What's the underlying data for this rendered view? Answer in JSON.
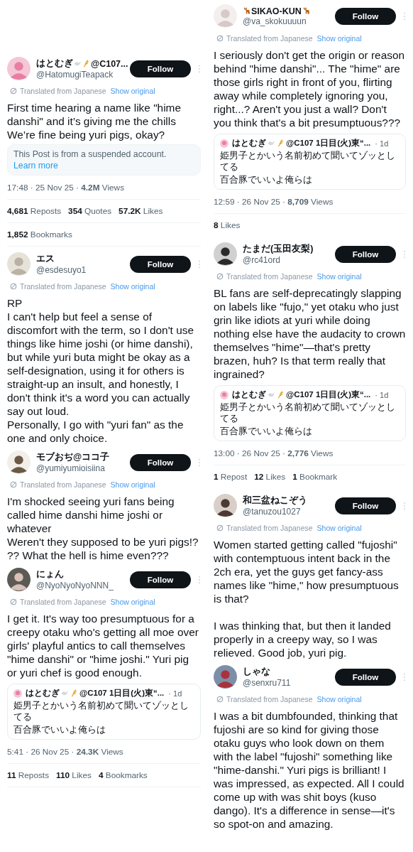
{
  "columns": [
    {
      "posts": [
        {
          "name_parts": [
            {
              "kind": "text",
              "text": "はとむぎ"
            },
            {
              "kind": "dove"
            },
            {
              "kind": "wheat"
            },
            {
              "kind": "text",
              "text": "@C107..."
            }
          ],
          "handle": "@HatomugiTeapack",
          "follow": "Follow",
          "translated": "Translated from Japanese",
          "show_original": "Show original",
          "body": [
            [
              "First time hearing a name like \"hime danshi\" and it’s giving me the chills",
              "We’re fine being yuri pigs, okay?"
            ]
          ],
          "notice": {
            "text": "This Post is from a suspended account.",
            "link": "Learn more"
          },
          "meta": "17:48 · 25 Nov 25 · **4.2M** Views",
          "stats": [
            [
              {
                "count": "4,681",
                "label": "Reposts"
              },
              {
                "count": "354",
                "label": "Quotes"
              },
              {
                "count": "57.2K",
                "label": "Likes"
              }
            ],
            [
              {
                "count": "1,852",
                "label": "Bookmarks"
              }
            ]
          ]
        },
        {
          "name_parts": [
            {
              "kind": "text",
              "text": "エス"
            }
          ],
          "handle": "@esdesuyo1",
          "follow": "Follow",
          "translated": "Translated from Japanese",
          "show_original": "Show original",
          "body": [
            [
              "RP",
              "I can't help but feel a sense of discomfort with the term, so I don't use things like hime joshi (or hime danshi), but while yuri buta might be okay as a self-designation, using it for others is straight-up an insult, and honestly, I don't think it's a word you can actually say out loud.",
              "Personally, I go with \"yuri fan\" as the one and only choice."
            ]
          ]
        },
        {
          "name_parts": [
            {
              "kind": "text",
              "text": "モブおぢ@ココ子"
            }
          ],
          "handle": "@yumiyumioisiina",
          "follow": "Follow",
          "translated": "Translated from Japanese",
          "show_original": "Show original",
          "body": [
            [
              "I'm shocked seeing yuri fans being called hime danshi hime joshi or whatever",
              "Weren't they supposed to be yuri pigs!? ?? What the hell is hime even???"
            ]
          ]
        },
        {
          "name_parts": [
            {
              "kind": "text",
              "text": "にょん"
            }
          ],
          "handle": "@NyoNyoNyoNNN_",
          "follow": "Follow",
          "translated": "Translated from Japanese",
          "show_original": "Show original",
          "body": [
            [
              "I get it. It's way too presumptuous for a creepy otaku who's getting all moe over girls' playful antics to call themselves \"hime danshi\" or \"hime joshi.\" Yuri pig or yuri chef is good enough."
            ]
          ],
          "quote": {
            "name_parts": [
              {
                "kind": "text",
                "text": "はとむぎ"
              },
              {
                "kind": "dove"
              },
              {
                "kind": "wheat"
              },
              {
                "kind": "text",
                "text": "@C107 1日目(火)東“..."
              }
            ],
            "age": "· 1d",
            "lines": [
              "姫男子とかいう名前初めて聞いてゾッとしてる",
              "百合豚でいいよ俺らは"
            ]
          },
          "meta": "5:41 · 26 Nov 25 · **24.3K** Views",
          "stats": [
            [
              {
                "count": "11",
                "label": "Reposts"
              },
              {
                "count": "110",
                "label": "Likes"
              },
              {
                "count": "4",
                "label": "Bookmarks"
              }
            ]
          ]
        }
      ]
    },
    {
      "posts": [
        {
          "name_parts": [
            {
              "kind": "deer"
            },
            {
              "kind": "text",
              "text": "SIKAO-KUN"
            },
            {
              "kind": "deer"
            }
          ],
          "handle": "@va_skokuuuun",
          "follow": "Follow",
          "translated": "Translated from Japanese",
          "show_original": "Show original",
          "body": [
            [
              "I seriously don't get the origin or reason behind \"hime danshi\"... The \"hime\" are those girls right in front of you, flirting away while completely ignoring you, right...? Aren't you just a wall? Don't you think that's a bit presumptuous???"
            ]
          ],
          "quote": {
            "name_parts": [
              {
                "kind": "text",
                "text": "はとむぎ"
              },
              {
                "kind": "dove"
              },
              {
                "kind": "wheat"
              },
              {
                "kind": "text",
                "text": "@C107 1日目(火)東“..."
              }
            ],
            "age": "· 1d",
            "lines": [
              "姫男子とかいう名前初めて聞いてゾッとしてる",
              "百合豚でいいよ俺らは"
            ]
          },
          "meta": "12:59 · 26 Nov 25 · **8,709** Views",
          "stats": [
            [
              {
                "count": "8",
                "label": "Likes"
              }
            ]
          ]
        },
        {
          "name_parts": [
            {
              "kind": "text",
              "text": "たまだ(玉田友梨)"
            }
          ],
          "handle": "@rc41ord",
          "follow": "Follow",
          "translated": "Translated from Japanese",
          "show_original": "Show original",
          "body": [
            [
              "BL fans are self-deprecatingly slapping on labels like \"fujo,\" yet otaku who just grin like idiots at yuri while doing nothing else have the audacity to crown themselves \"hime\"—that's pretty brazen, huh? Is that term really that ingrained?"
            ]
          ],
          "quote": {
            "name_parts": [
              {
                "kind": "text",
                "text": "はとむぎ"
              },
              {
                "kind": "dove"
              },
              {
                "kind": "wheat"
              },
              {
                "kind": "text",
                "text": "@C107 1日目(火)東“..."
              }
            ],
            "age": "· 1d",
            "lines": [
              "姫男子とかいう名前初めて聞いてゾッとしてる",
              "百合豚でいいよ俺らは"
            ]
          },
          "meta": "13:00 · 26 Nov 25 · **2,776** Views",
          "stats": [
            [
              {
                "count": "1",
                "label": "Repost"
              },
              {
                "count": "12",
                "label": "Likes"
              },
              {
                "count": "1",
                "label": "Bookmark"
              }
            ]
          ]
        },
        {
          "name_parts": [
            {
              "kind": "text",
              "text": "和三盆ねこぞう"
            }
          ],
          "handle": "@tanuzou1027",
          "follow": "Follow",
          "translated": "Translated from Japanese",
          "show_original": "Show original",
          "body": [
            [
              "Women started getting called \"fujoshi\" with contemptuous intent back in the 2ch era, yet the guys get fancy-ass names like \"hime,\" how presumptuous is that?"
            ],
            [
              "I was thinking that, but then it landed properly in a creepy way, so I was relieved. Good job, yuri pig."
            ]
          ]
        },
        {
          "name_parts": [
            {
              "kind": "text",
              "text": "しゃな"
            }
          ],
          "handle": "@senxru711",
          "follow": "Follow",
          "translated": "Translated from Japanese",
          "show_original": "Show original",
          "body": [
            [
              "I was a bit dumbfounded, thinking that fujoshi are so kind for giving those otaku guys who look down on them with the label \"fujoshi\" something like \"hime-danshi.\" Yuri pigs is brilliant! I was impressed, as expected. All I could come up with was shit boys (kuso dango). It's a difference in sense—it's so spot-on and amazing."
            ]
          ]
        }
      ]
    }
  ]
}
